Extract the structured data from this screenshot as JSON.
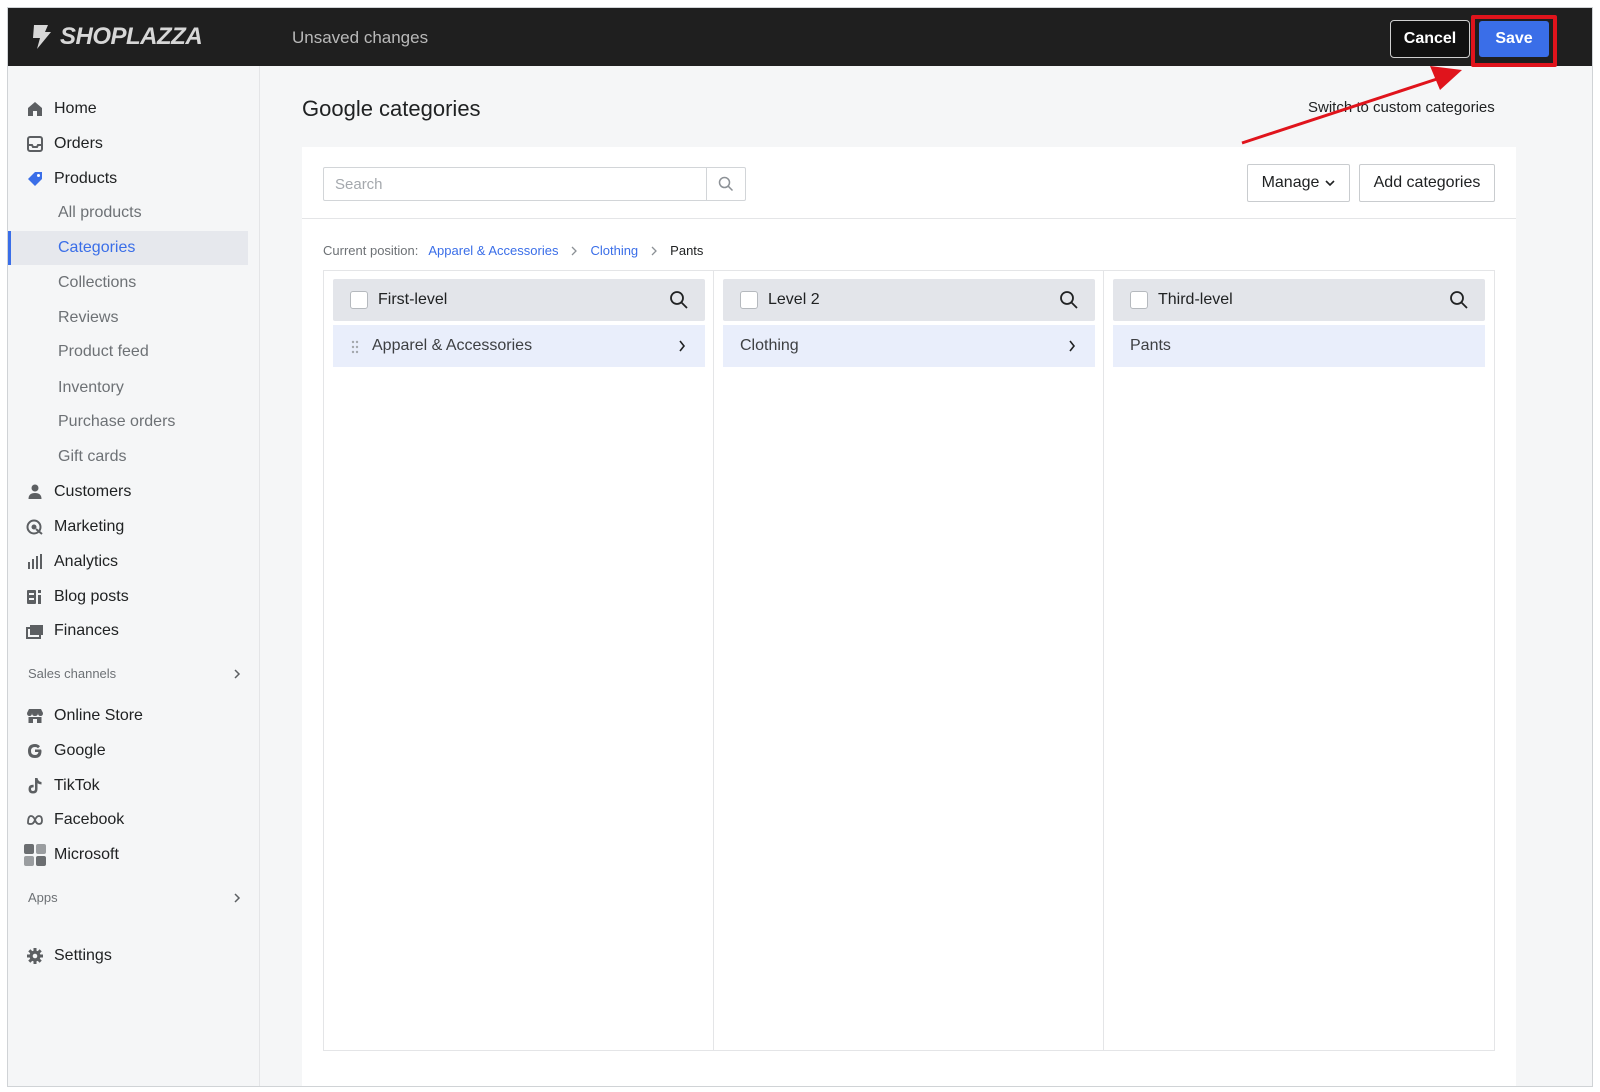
{
  "topbar": {
    "logo_text": "SHOPLAZZA",
    "status": "Unsaved changes",
    "cancel_label": "Cancel",
    "save_label": "Save"
  },
  "sidebar": {
    "items": [
      {
        "label": "Home",
        "icon": "home-icon"
      },
      {
        "label": "Orders",
        "icon": "inbox-icon"
      },
      {
        "label": "Products",
        "icon": "tag-icon"
      }
    ],
    "product_subitems": [
      {
        "label": "All products"
      },
      {
        "label": "Categories",
        "active": true
      },
      {
        "label": "Collections"
      },
      {
        "label": "Reviews"
      },
      {
        "label": "Product feed"
      },
      {
        "label": "Inventory"
      },
      {
        "label": "Purchase orders"
      },
      {
        "label": "Gift cards"
      }
    ],
    "items2": [
      {
        "label": "Customers",
        "icon": "person-icon"
      },
      {
        "label": "Marketing",
        "icon": "marketing-icon"
      },
      {
        "label": "Analytics",
        "icon": "bar-chart-icon"
      },
      {
        "label": "Blog posts",
        "icon": "blog-icon"
      },
      {
        "label": "Finances",
        "icon": "finance-icon"
      }
    ],
    "sales_channels_label": "Sales channels",
    "channels": [
      {
        "label": "Online Store",
        "icon": "store-icon"
      },
      {
        "label": "Google",
        "icon": "google-icon"
      },
      {
        "label": "TikTok",
        "icon": "tiktok-icon"
      },
      {
        "label": "Facebook",
        "icon": "meta-icon"
      },
      {
        "label": "Microsoft",
        "icon": "microsoft-icon"
      }
    ],
    "apps_label": "Apps",
    "settings_label": "Settings"
  },
  "main": {
    "title": "Google categories",
    "switch_link": "Switch to custom categories",
    "search_placeholder": "Search",
    "manage_label": "Manage",
    "add_label": "Add categories",
    "breadcrumb": {
      "lead": "Current position:",
      "path": [
        "Apparel & Accessories",
        "Clothing"
      ],
      "current": "Pants"
    },
    "columns": [
      {
        "title": "First-level",
        "rows": [
          {
            "label": "Apparel & Accessories",
            "has_children": true,
            "draggable": true
          }
        ]
      },
      {
        "title": "Level 2",
        "rows": [
          {
            "label": "Clothing",
            "has_children": true
          }
        ]
      },
      {
        "title": "Third-level",
        "rows": [
          {
            "label": "Pants",
            "has_children": false
          }
        ]
      }
    ]
  },
  "colors": {
    "accent": "#3a6ee8",
    "topbar_bg": "#1f1f1f",
    "annotation_red": "#e0141c",
    "row_selected": "#e9eefb"
  }
}
